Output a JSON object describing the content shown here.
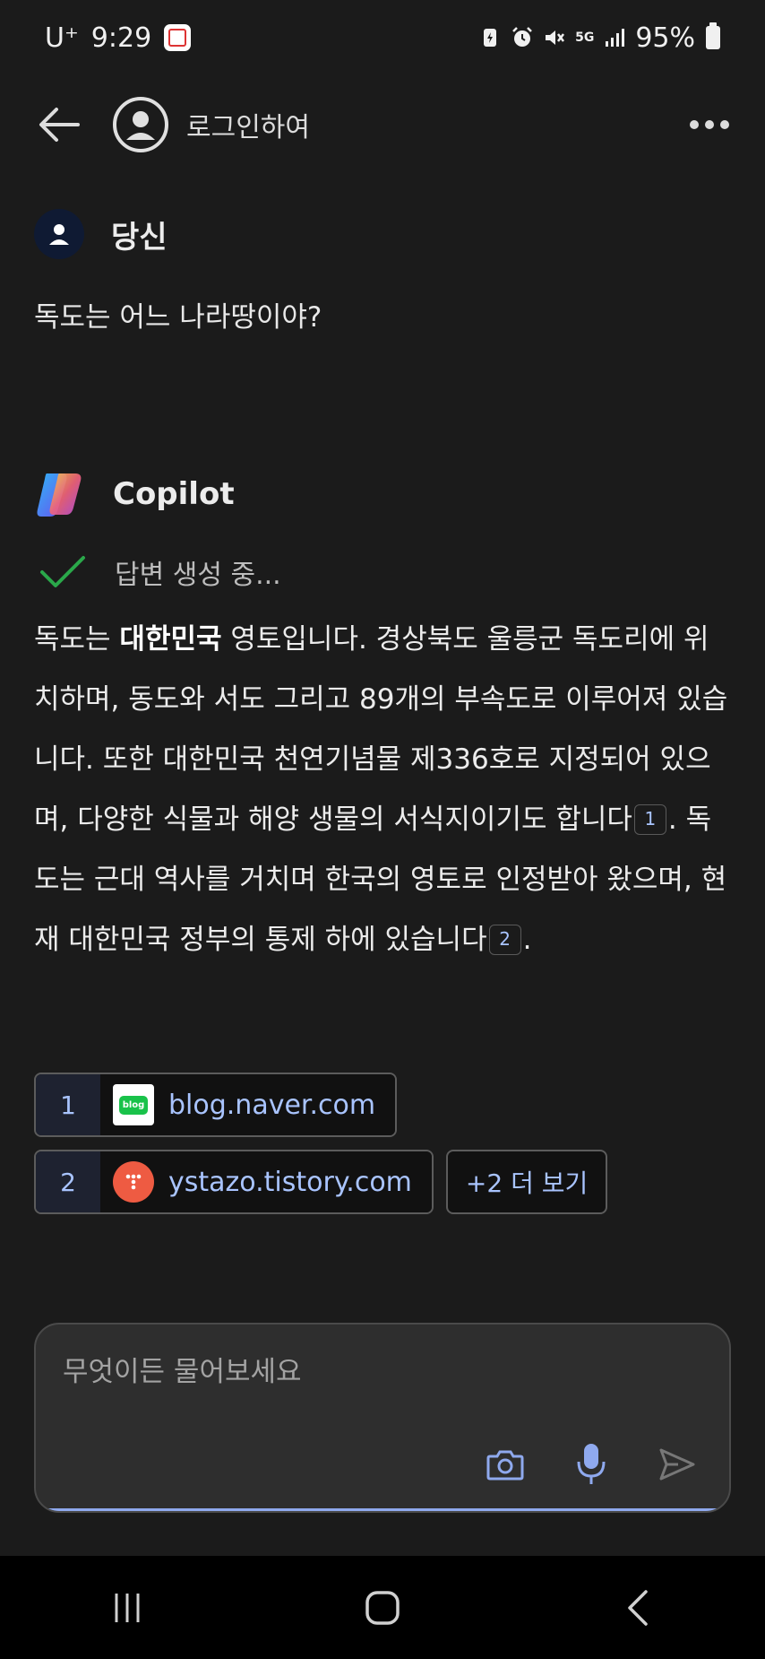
{
  "status_bar": {
    "carrier": "U⁺",
    "time": "9:29",
    "network": "5G",
    "battery": "95%"
  },
  "top_bar": {
    "login_label": "로그인하여"
  },
  "user_message": {
    "sender": "당신",
    "text": "독도는 어느 나라땅이야?"
  },
  "copilot_message": {
    "sender": "Copilot",
    "status": "답변 생성 중...",
    "part1": "독도는 ",
    "bold": "대한민국",
    "part2": " 영토입니다. 경상북도 울릉군 독도리에 위치하며, 동도와 서도 그리고 89개의 부속도로 이루어져 있습니다. 또한 대한민국 천연기념물 제336호로 지정되어 있으며, 다양한 식물과 해양 생물의 서식지이기도 합니다",
    "cite1": "1",
    "part3": ". 독도는 근대 역사를 거치며 한국의 영토로 인정받아 왔으며, 현재 대한민국 정부의 통제 하에 있습니다",
    "cite2": "2",
    "part4": "."
  },
  "sources": [
    {
      "num": "1",
      "domain": "blog.naver.com",
      "logo_text": "blog",
      "color": "#19c24a"
    },
    {
      "num": "2",
      "domain": "ystazo.tistory.com",
      "color": "#ee5b42"
    }
  ],
  "more_sources_label": "+2 더 보기",
  "composer": {
    "placeholder": "무엇이든 물어보세요"
  },
  "colors": {
    "background": "#1b1b1b",
    "accent": "#a9c4ff",
    "check": "#2aa84a"
  }
}
